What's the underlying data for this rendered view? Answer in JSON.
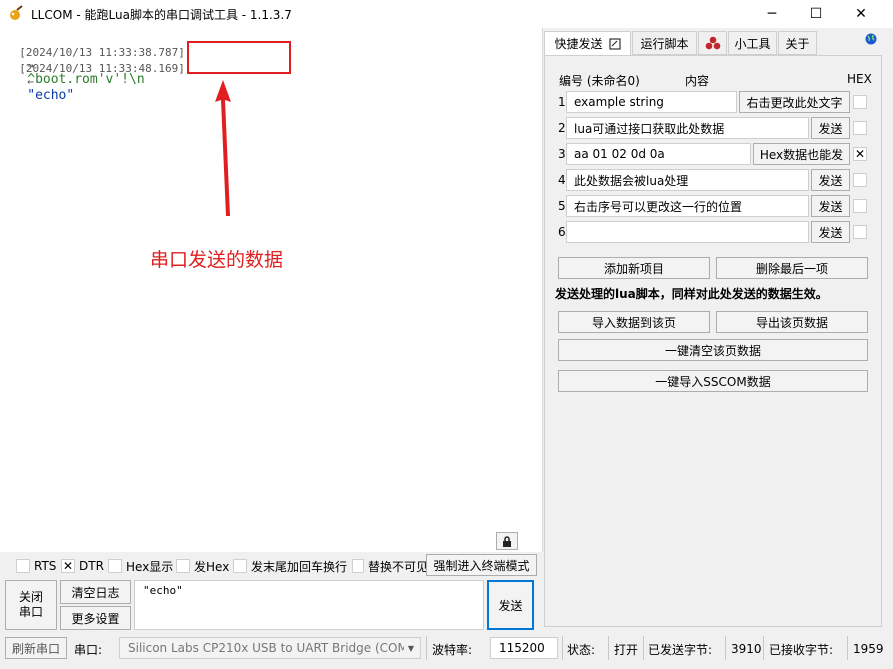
{
  "window": {
    "title": "LLCOM - 能跑Lua脚本的串口调试工具 - 1.1.3.7",
    "minimize": "─",
    "maximize": "☐",
    "close": "✕"
  },
  "log": {
    "lines": [
      {
        "time": "[2024/10/13 11:33:38.787]",
        "arrow": "→",
        "data": "^boot.rom'v'!\\n"
      },
      {
        "time": "[2024/10/13 11:33:48.169]",
        "arrow": "←",
        "data": "\"echo\""
      }
    ],
    "annotation": "串口发送的数据"
  },
  "options": {
    "rts": "RTS",
    "dtr": "DTR",
    "hex_show": "Hex显示",
    "send_hex": "发Hex",
    "append_crlf": "发末尾加回车换行",
    "replace_invisible": "替换不可见",
    "force_terminal": "强制进入终端模式"
  },
  "buttons": {
    "close_port": "关闭\n串口",
    "clear_log": "清空日志",
    "more_settings": "更多设置",
    "send": "发送"
  },
  "send_input": "\"echo\"",
  "status": {
    "refresh_port": "刷新串口",
    "port_label": "串口:",
    "port_value": "Silicon Labs CP210x USB to UART Bridge (COM8)",
    "baud_label": "波特率:",
    "baud_value": "115200",
    "state_label": "状态:",
    "state_value": "打开",
    "sent_label": "已发送字节:",
    "sent_value": "3910",
    "recv_label": "已接收字节:",
    "recv_value": "1959"
  },
  "tabs": [
    "快捷发送",
    "运行脚本",
    "",
    "小工具",
    "关于"
  ],
  "quick_send": {
    "header_no": "编号 (未命名0)",
    "header_content": "内容",
    "header_hex": "HEX",
    "rows": [
      {
        "num": "1",
        "text": "example string",
        "button": "右击更改此处文字",
        "hex": false
      },
      {
        "num": "2",
        "text": "lua可通过接口获取此处数据",
        "button": "发送",
        "hex": false
      },
      {
        "num": "3",
        "text": "aa 01 02 0d 0a",
        "button": "Hex数据也能发",
        "hex": true
      },
      {
        "num": "4",
        "text": "此处数据会被lua处理",
        "button": "发送",
        "hex": false
      },
      {
        "num": "5",
        "text": "右击序号可以更改这一行的位置",
        "button": "发送",
        "hex": false
      },
      {
        "num": "6",
        "text": "",
        "button": "发送",
        "hex": false
      }
    ],
    "add_item": "添加新项目",
    "delete_last": "删除最后一项",
    "lua_note": "发送处理的lua脚本，同样对此处发送的数据生效。",
    "import_page": "导入数据到该页",
    "export_page": "导出该页数据",
    "clear_page": "一键清空该页数据",
    "import_sscom": "一键导入SSCOM数据"
  },
  "colors": {
    "annotation": "#e02020",
    "accent": "#0078d7"
  }
}
